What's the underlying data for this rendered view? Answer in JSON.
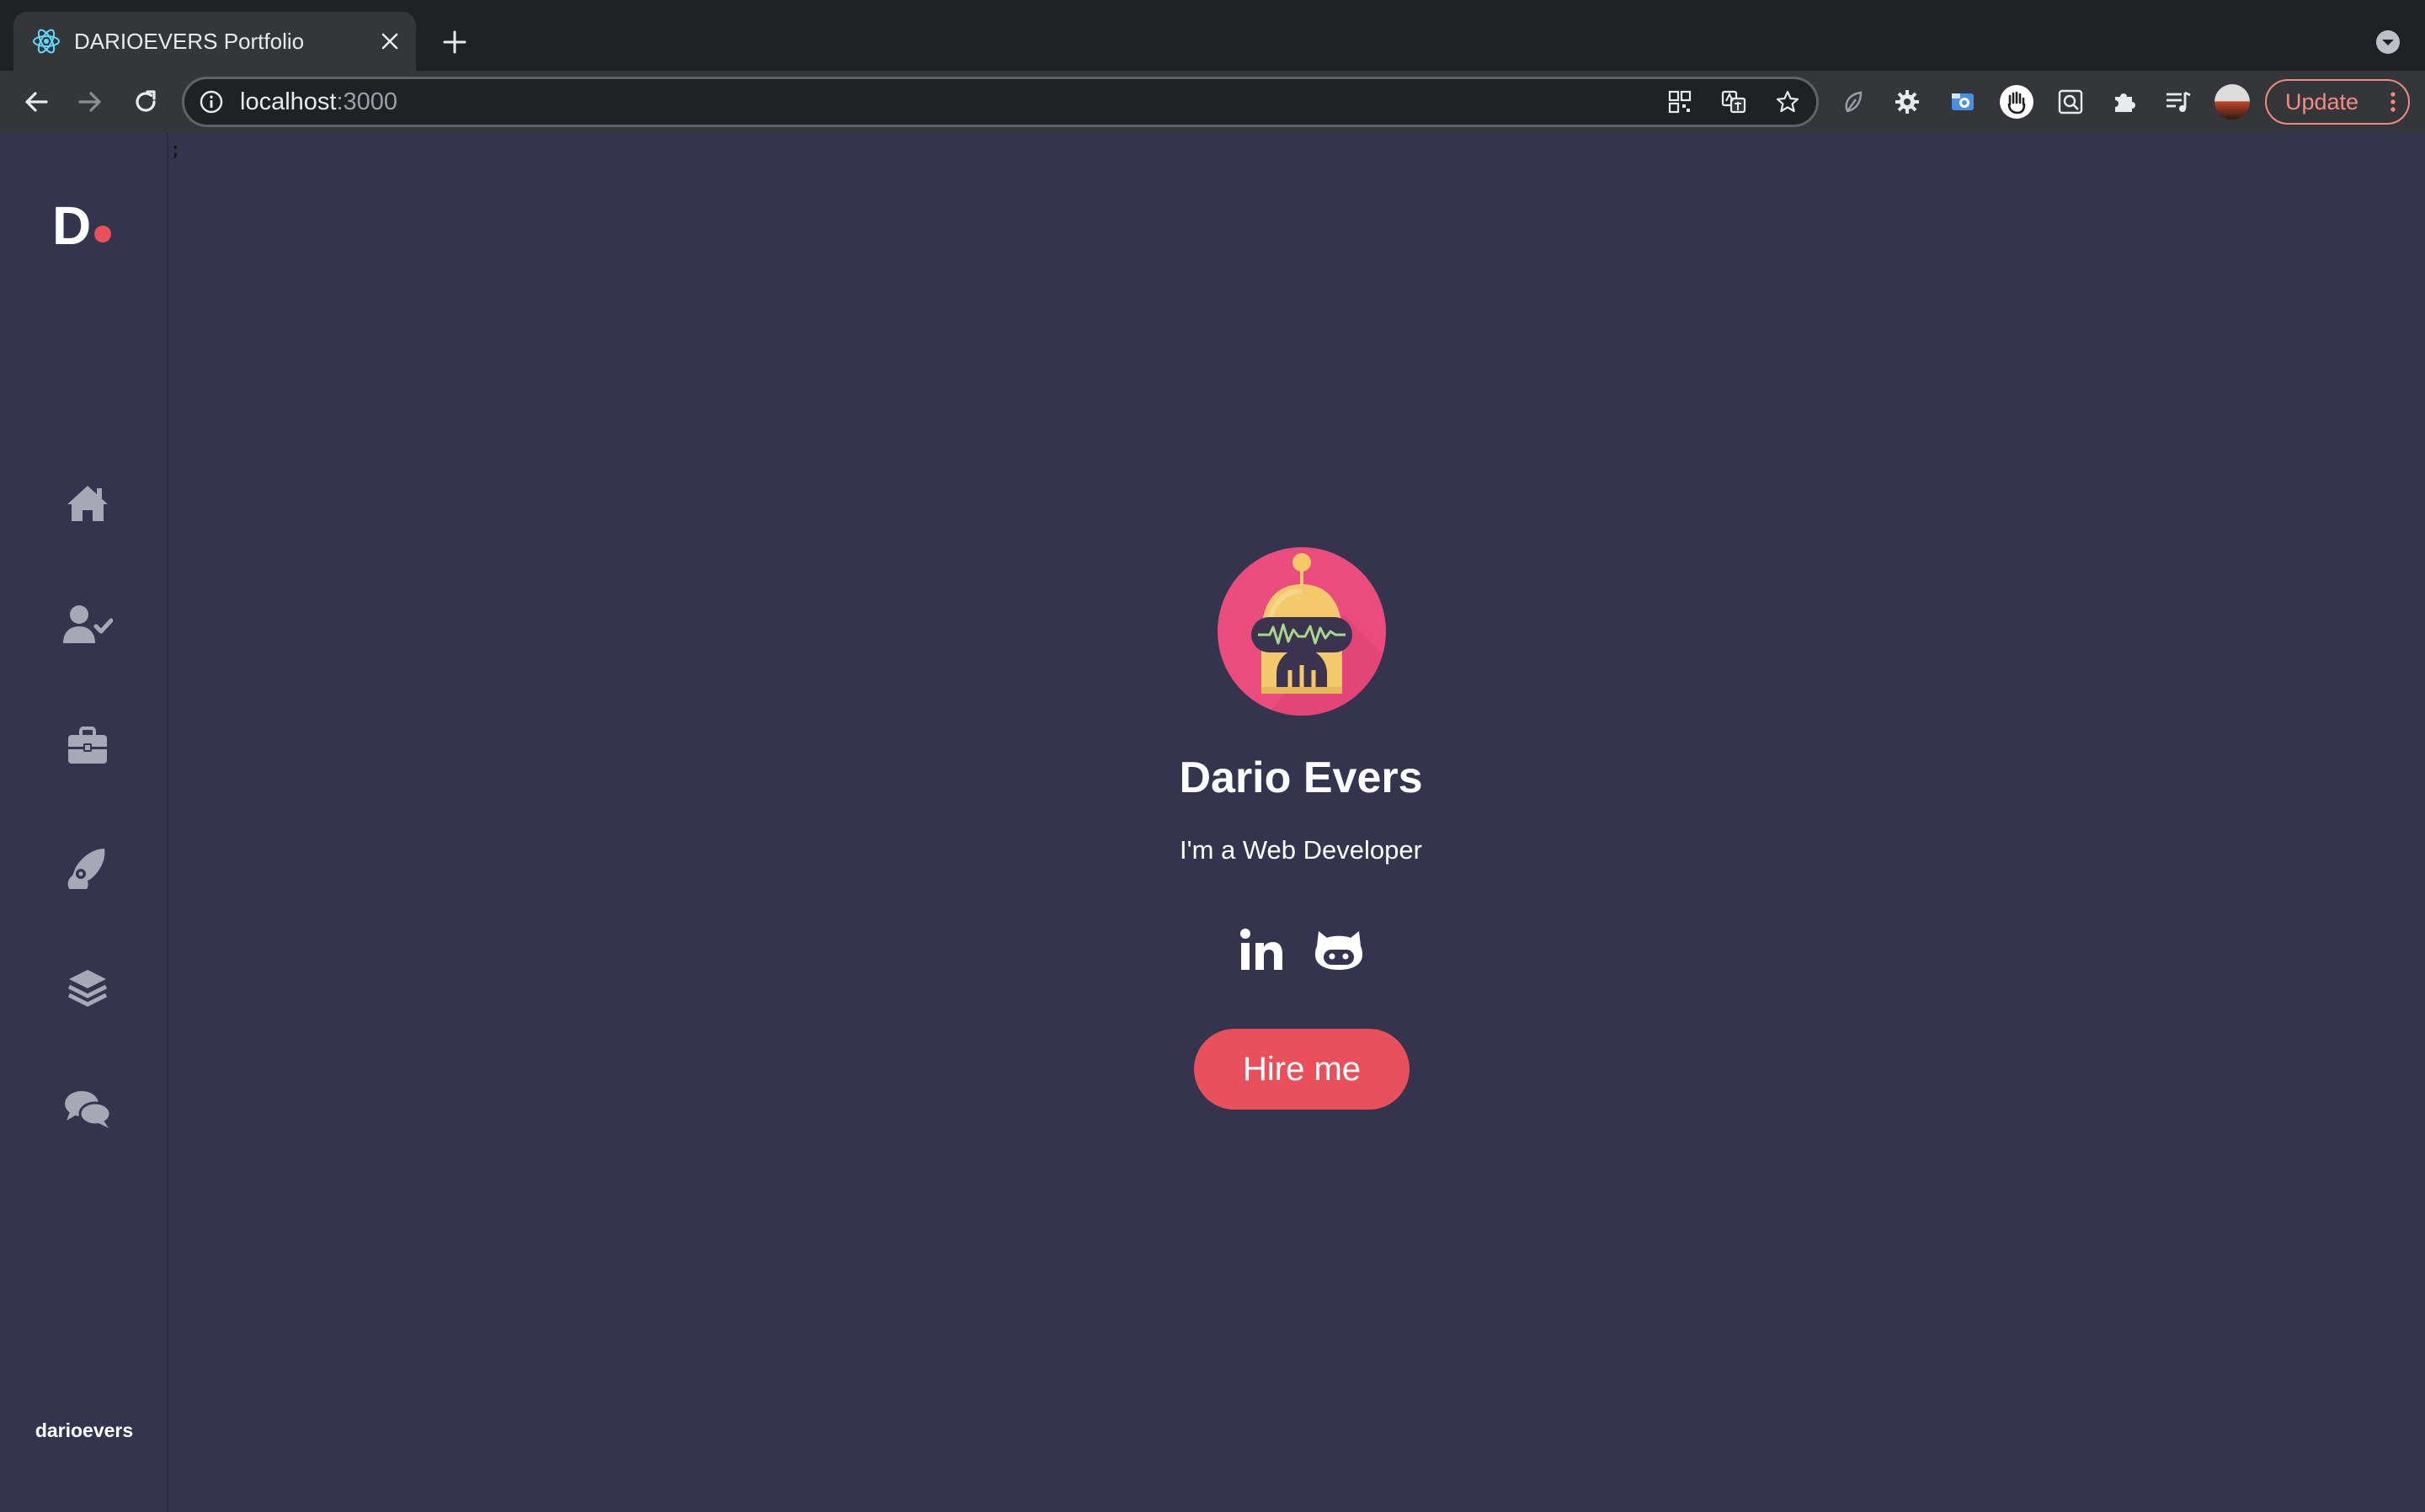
{
  "browser": {
    "tab_title": "DARIOEVERS Portfolio",
    "url_host": "localhost",
    "url_port": ":3000",
    "update_label": "Update"
  },
  "site": {
    "logo_letter": "D",
    "nav": [
      {
        "icon": "home-icon"
      },
      {
        "icon": "user-check-icon"
      },
      {
        "icon": "briefcase-icon"
      },
      {
        "icon": "rocket-icon"
      },
      {
        "icon": "layers-icon"
      },
      {
        "icon": "comments-icon"
      }
    ],
    "handle": "darioevers",
    "caret": ";"
  },
  "hero": {
    "avatar_icon": "robot-avatar-icon",
    "name": "Dario Evers",
    "role": "I'm a Web Developer",
    "socials": [
      {
        "icon": "linkedin-icon"
      },
      {
        "icon": "github-icon"
      }
    ],
    "cta_label": "Hire me"
  },
  "colors": {
    "background": "#35344f",
    "accent": "#e8505b",
    "avatar_bg": "#ea4c7e",
    "icon_grey": "#a7a7b6",
    "chrome_dark": "#202124",
    "chrome_toolbar": "#35363a"
  }
}
